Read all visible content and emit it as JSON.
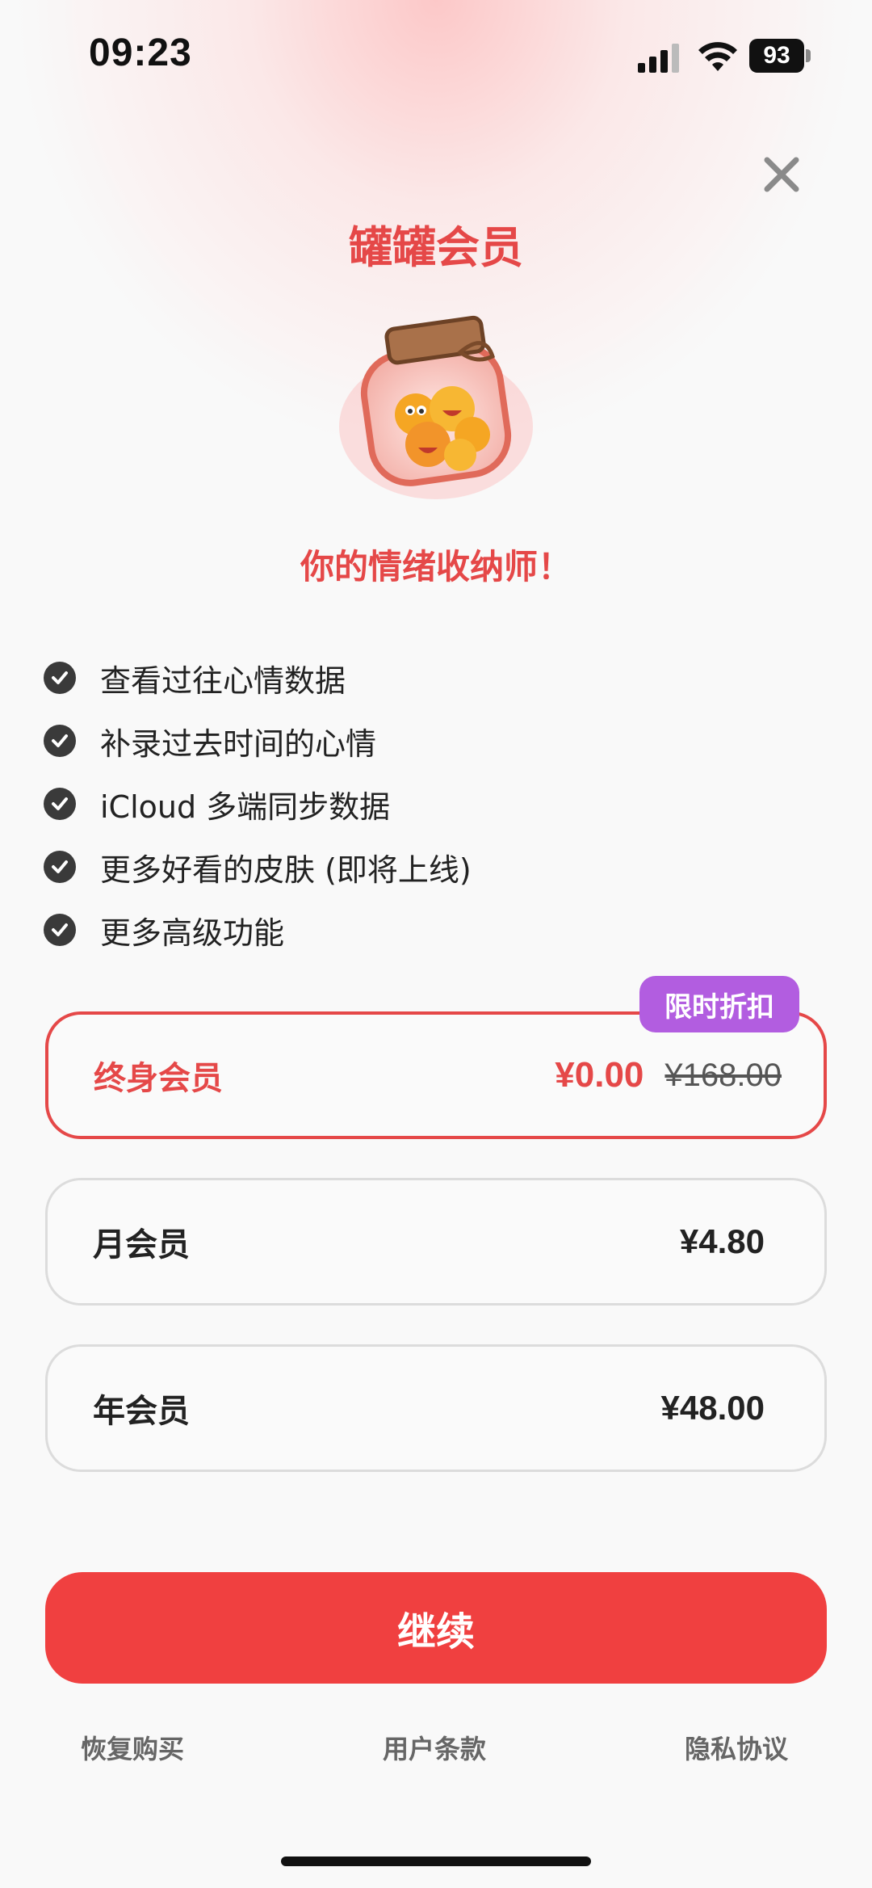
{
  "status_bar": {
    "time": "09:23",
    "battery": "93"
  },
  "header": {
    "title": "罐罐会员",
    "subtitle": "你的情绪收纳师！"
  },
  "features": [
    "查看过往心情数据",
    "补录过去时间的心情",
    "iCloud 多端同步数据",
    "更多好看的皮肤 (即将上线)",
    "更多高级功能"
  ],
  "plans": {
    "lifetime": {
      "name": "终身会员",
      "price": "¥0.00",
      "original_price": "¥168.00",
      "badge": "限时折扣"
    },
    "monthly": {
      "name": "月会员",
      "price": "¥4.80"
    },
    "yearly": {
      "name": "年会员",
      "price": "¥48.00"
    }
  },
  "actions": {
    "continue": "继续"
  },
  "footer": {
    "restore": "恢复购买",
    "terms": "用户条款",
    "privacy": "隐私协议"
  },
  "colors": {
    "accent": "#e54848",
    "badge": "#b25de0",
    "button": "#f04040"
  }
}
